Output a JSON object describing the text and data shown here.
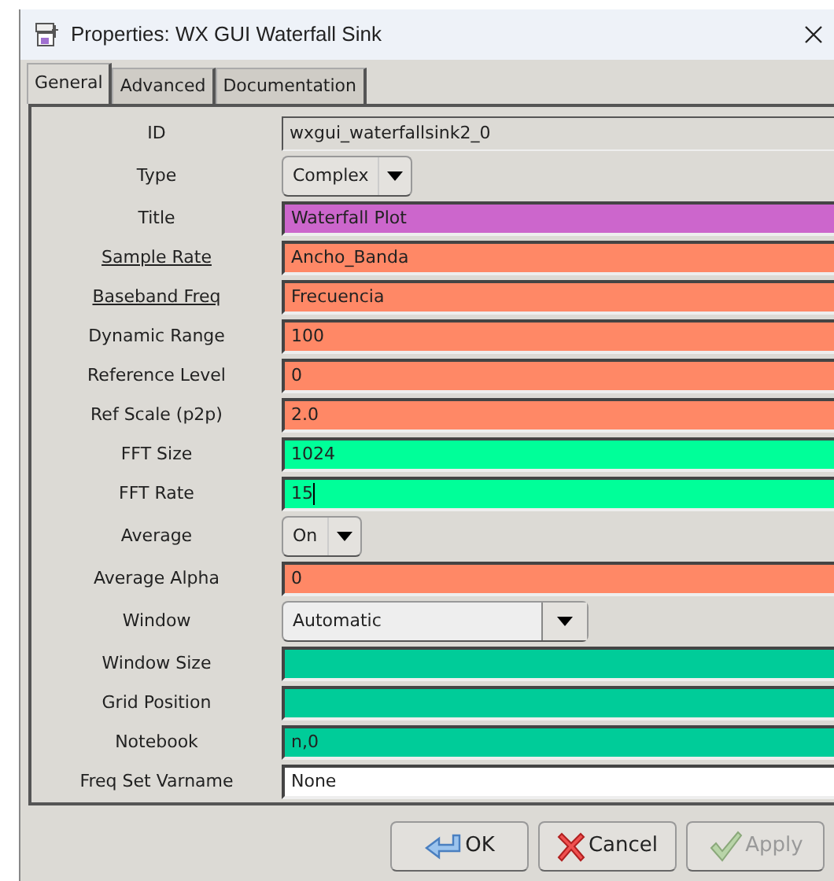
{
  "window": {
    "title": "Properties: WX GUI Waterfall Sink"
  },
  "tabs": [
    {
      "label": "General",
      "selected": true
    },
    {
      "label": "Advanced",
      "selected": false
    },
    {
      "label": "Documentation",
      "selected": false
    }
  ],
  "params": [
    {
      "label": "ID",
      "underlined": false,
      "kind": "readonly",
      "value": "wxgui_waterfallsink2_0"
    },
    {
      "label": "Type",
      "underlined": false,
      "kind": "select",
      "value": "Complex",
      "wide": false
    },
    {
      "label": "Title",
      "underlined": false,
      "kind": "entry",
      "value": "Waterfall Plot",
      "color": "#cc66cc",
      "focused": false
    },
    {
      "label": "Sample Rate",
      "underlined": true,
      "kind": "entry",
      "value": "Ancho_Banda",
      "color": "#ff8866",
      "focused": false
    },
    {
      "label": "Baseband Freq",
      "underlined": true,
      "kind": "entry",
      "value": "Frecuencia",
      "color": "#ff8866",
      "focused": false
    },
    {
      "label": "Dynamic Range",
      "underlined": false,
      "kind": "entry",
      "value": "100",
      "color": "#ff8866",
      "focused": false
    },
    {
      "label": "Reference Level",
      "underlined": false,
      "kind": "entry",
      "value": "0",
      "color": "#ff8866",
      "focused": false
    },
    {
      "label": "Ref Scale (p2p)",
      "underlined": false,
      "kind": "entry",
      "value": "2.0",
      "color": "#ff8866",
      "focused": false
    },
    {
      "label": "FFT Size",
      "underlined": false,
      "kind": "entry",
      "value": "1024",
      "color": "#00ff99",
      "focused": false
    },
    {
      "label": "FFT Rate",
      "underlined": false,
      "kind": "entry",
      "value": "15",
      "color": "#00ff99",
      "focused": true
    },
    {
      "label": "Average",
      "underlined": false,
      "kind": "select",
      "value": "On",
      "wide": false
    },
    {
      "label": "Average Alpha",
      "underlined": false,
      "kind": "entry",
      "value": "0",
      "color": "#ff8866",
      "focused": false
    },
    {
      "label": "Window",
      "underlined": false,
      "kind": "select",
      "value": "Automatic",
      "wide": true
    },
    {
      "label": "Window Size",
      "underlined": false,
      "kind": "entry",
      "color": "#00cc99",
      "focused": false
    },
    {
      "label": "Grid Position",
      "underlined": false,
      "kind": "entry",
      "color": "#00cc99",
      "focused": false
    },
    {
      "label": "Notebook",
      "underlined": false,
      "kind": "entry",
      "value": "n,0",
      "color": "#00cc99",
      "focused": false
    },
    {
      "label": "Freq Set Varname",
      "underlined": false,
      "kind": "entry",
      "value": "None",
      "color": "#ffffff",
      "focused": false
    }
  ],
  "buttons": [
    {
      "label": "OK",
      "kind": "ok",
      "disabled": false
    },
    {
      "label": "Cancel",
      "kind": "cancel",
      "disabled": false
    },
    {
      "label": "Apply",
      "kind": "apply",
      "disabled": true
    }
  ]
}
